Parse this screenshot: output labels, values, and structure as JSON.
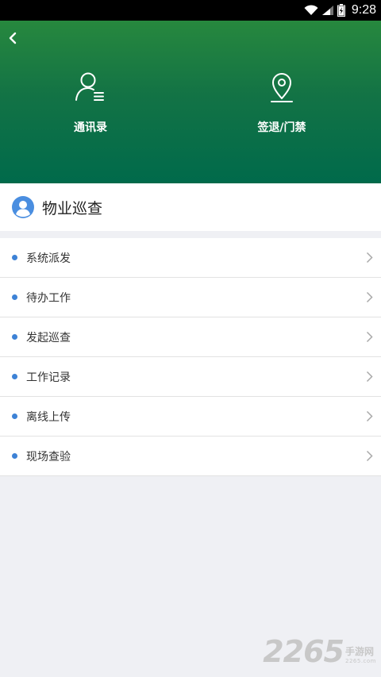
{
  "status_bar": {
    "time": "9:28"
  },
  "header": {
    "shortcuts": [
      {
        "label": "通讯录",
        "icon": "contacts-icon"
      },
      {
        "label": "签退/门禁",
        "icon": "location-pin-icon"
      }
    ]
  },
  "section": {
    "title": "物业巡查",
    "icon": "user-avatar-icon"
  },
  "menu": {
    "items": [
      {
        "label": "系统派发"
      },
      {
        "label": "待办工作"
      },
      {
        "label": "发起巡查"
      },
      {
        "label": "工作记录"
      },
      {
        "label": "离线上传"
      },
      {
        "label": "现场查验"
      }
    ]
  },
  "watermark": {
    "number": "2265",
    "cn": "手游网",
    "domain": "2265.com"
  },
  "colors": {
    "header_top": "#27883e",
    "header_bottom": "#006a4b",
    "bullet": "#3d82d6",
    "background": "#eff0f4"
  }
}
